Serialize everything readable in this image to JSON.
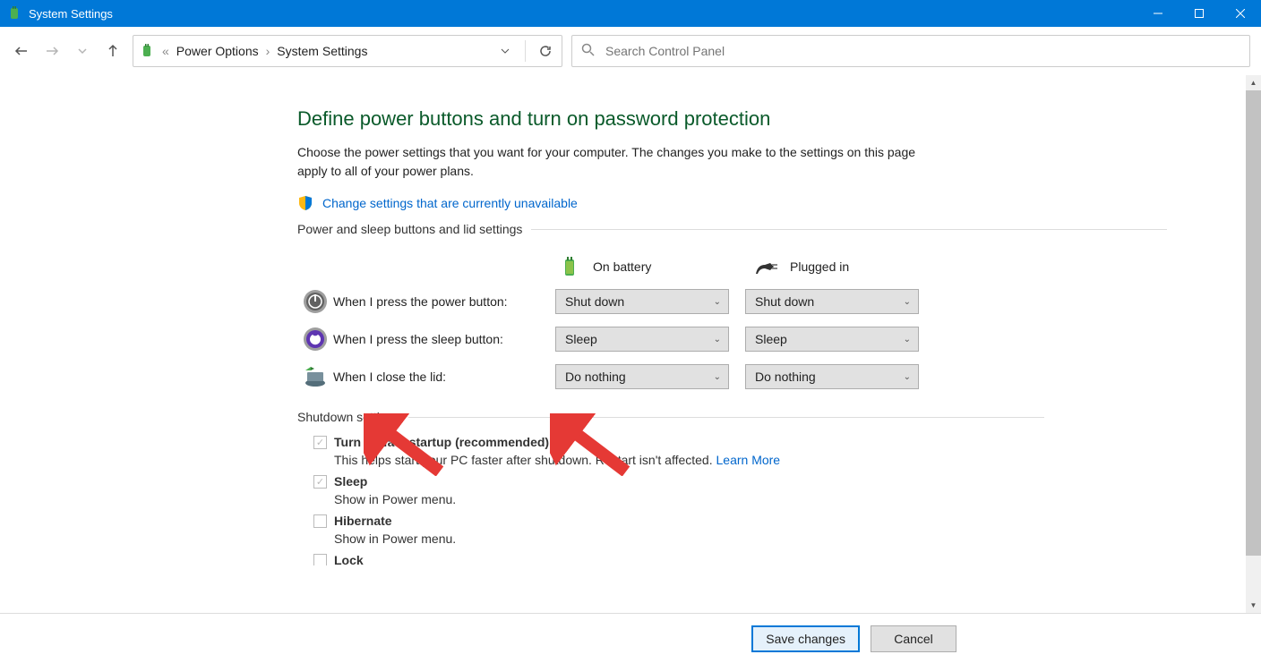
{
  "window": {
    "title": "System Settings"
  },
  "breadcrumb": {
    "root_label": "Power Options",
    "current_label": "System Settings"
  },
  "search": {
    "placeholder": "Search Control Panel"
  },
  "page": {
    "title": "Define power buttons and turn on password protection",
    "description": "Choose the power settings that you want for your computer. The changes you make to the settings on this page apply to all of your power plans.",
    "change_link": "Change settings that are currently unavailable"
  },
  "power_section": {
    "label": "Power and sleep buttons and lid settings",
    "col_battery": "On battery",
    "col_plugged": "Plugged in",
    "rows": {
      "power_button": {
        "label": "When I press the power button:",
        "battery": "Shut down",
        "plugged": "Shut down"
      },
      "sleep_button": {
        "label": "When I press the sleep button:",
        "battery": "Sleep",
        "plugged": "Sleep"
      },
      "lid": {
        "label": "When I close the lid:",
        "battery": "Do nothing",
        "plugged": "Do nothing"
      }
    }
  },
  "shutdown_section": {
    "label": "Shutdown settings",
    "fast_startup": {
      "label": "Turn on fast startup (recommended)",
      "sub": "This helps start your PC faster after shutdown. Restart isn't affected. ",
      "learn_more": "Learn More"
    },
    "sleep": {
      "label": "Sleep",
      "sub": "Show in Power menu."
    },
    "hibernate": {
      "label": "Hibernate",
      "sub": "Show in Power menu."
    },
    "lock": {
      "label": "Lock"
    }
  },
  "footer": {
    "save": "Save changes",
    "cancel": "Cancel"
  }
}
